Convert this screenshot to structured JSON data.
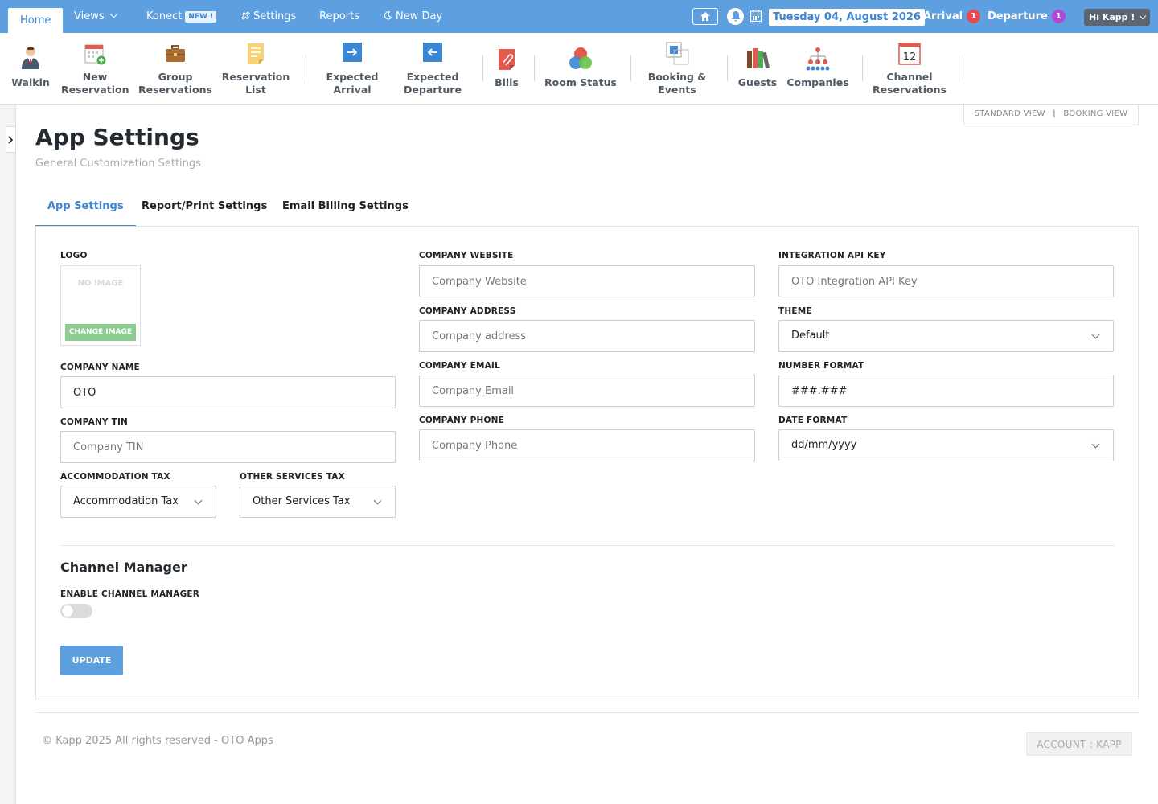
{
  "topnav": {
    "tabs": {
      "home": "Home",
      "views": "Views",
      "konect": "Konect",
      "konect_badge": "NEW !",
      "settings": "Settings",
      "reports": "Reports",
      "new_day": "New Day"
    },
    "date": "Tuesday 04, August 2026",
    "arrival_label": "Arrival",
    "arrival_count": "1",
    "departure_label": "Departure",
    "departure_count": "1",
    "user_greeting": "Hi Kapp !",
    "colors": {
      "bar": "#5d9fdf",
      "arrival_badge": "#e9494b",
      "departure_badge": "#b348d8"
    }
  },
  "toolbar": {
    "walkin": "Walkin",
    "new_res_1": "New",
    "new_res_2": "Reservation",
    "group_1": "Group",
    "group_2": "Reservations",
    "reslist_1": "Reservation",
    "reslist_2": "List",
    "exp_arr_1": "Expected",
    "exp_arr_2": "Arrival",
    "exp_dep_1": "Expected",
    "exp_dep_2": "Departure",
    "bills": "Bills",
    "room_status": "Room Status",
    "booking_1": "Booking &",
    "booking_2": "Events",
    "guests": "Guests",
    "companies": "Companies",
    "channel_1": "Channel",
    "channel_2": "Reservations",
    "channel_icon_number": "12"
  },
  "view_switch": {
    "standard": "STANDARD VIEW",
    "separator": "|",
    "booking": "BOOKING VIEW"
  },
  "page": {
    "title": "App Settings",
    "subtitle": "General Customization Settings",
    "tabs": [
      "App Settings",
      "Report/Print Settings",
      "Email Billing Settings"
    ]
  },
  "form": {
    "logo_label": "LOGO",
    "no_image": "NO IMAGE",
    "change_image": "CHANGE IMAGE",
    "company_name_label": "COMPANY NAME",
    "company_name_value": "OTO",
    "company_tin_label": "COMPANY TIN",
    "company_tin_placeholder": "Company TIN",
    "accommodation_tax_label": "ACCOMMODATION TAX",
    "accommodation_tax_value": "Accommodation Tax",
    "other_services_tax_label": "OTHER SERVICES TAX",
    "other_services_tax_value": "Other Services Tax",
    "company_website_label": "COMPANY WEBSITE",
    "company_website_placeholder": "Company Website",
    "company_address_label": "COMPANY ADDRESS",
    "company_address_placeholder": "Company address",
    "company_email_label": "COMPANY EMAIL",
    "company_email_placeholder": "Company Email",
    "company_phone_label": "COMPANY PHONE",
    "company_phone_placeholder": "Company Phone",
    "api_key_label": "INTEGRATION API KEY",
    "api_key_placeholder": "OTO Integration API Key",
    "theme_label": "THEME",
    "theme_value": "Default",
    "number_format_label": "NUMBER FORMAT",
    "number_format_value": "###.###",
    "date_format_label": "DATE FORMAT",
    "date_format_value": "dd/mm/yyyy"
  },
  "channel_manager": {
    "title": "Channel Manager",
    "enable_label": "ENABLE CHANNEL MANAGER",
    "enabled": false
  },
  "update_button": "UPDATE",
  "footer": {
    "copyright": "© Kapp 2025 All rights reserved - OTO Apps",
    "account": "ACCOUNT : KAPP"
  }
}
